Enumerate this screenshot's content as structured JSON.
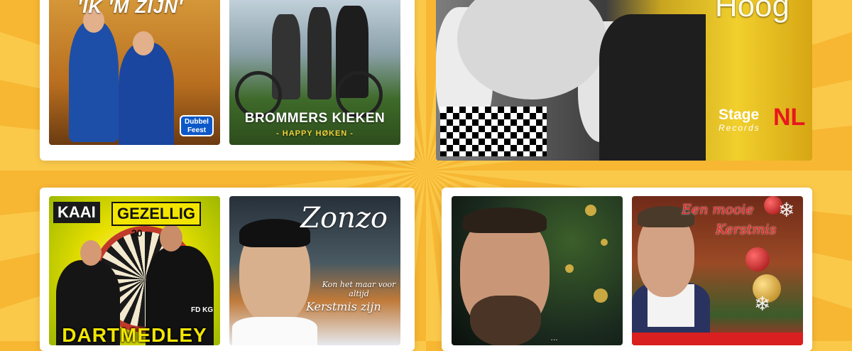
{
  "albums": [
    {
      "title_partial": "'IK 'M ZIJN'",
      "logo": [
        "Dubbel",
        "Feest"
      ],
      "icon": "music-cover"
    },
    {
      "title": "BROMMERS KIEKEN",
      "subtitle": "- HAPPY HØKEN -",
      "icon": "music-cover"
    },
    {
      "title": "Hoog",
      "label": {
        "stage": "Stage",
        "records": "Records",
        "nl": "NL"
      },
      "icon": "music-cover"
    },
    {
      "banner_left": "KAAI",
      "banner_right": "GEZELLIG",
      "board_number": "20",
      "shirt_text": "FD KG",
      "title": "DARTMEDLEY",
      "icon": "music-cover"
    },
    {
      "artist": "Zonzo",
      "subtitle_line1": "Kon het maar voor altijd",
      "subtitle_line2": "Kerstmis zijn",
      "icon": "music-cover"
    },
    {
      "bottom_text": "...",
      "icon": "music-cover"
    },
    {
      "title_line1": "Een mooie",
      "title_line2": "Kerstmis",
      "icon": "music-cover"
    }
  ],
  "colors": {
    "background": "#f7b733",
    "panel": "#ffffff",
    "stage_nl_red": "#e8171e",
    "darts_yellow": "#f2e600"
  }
}
